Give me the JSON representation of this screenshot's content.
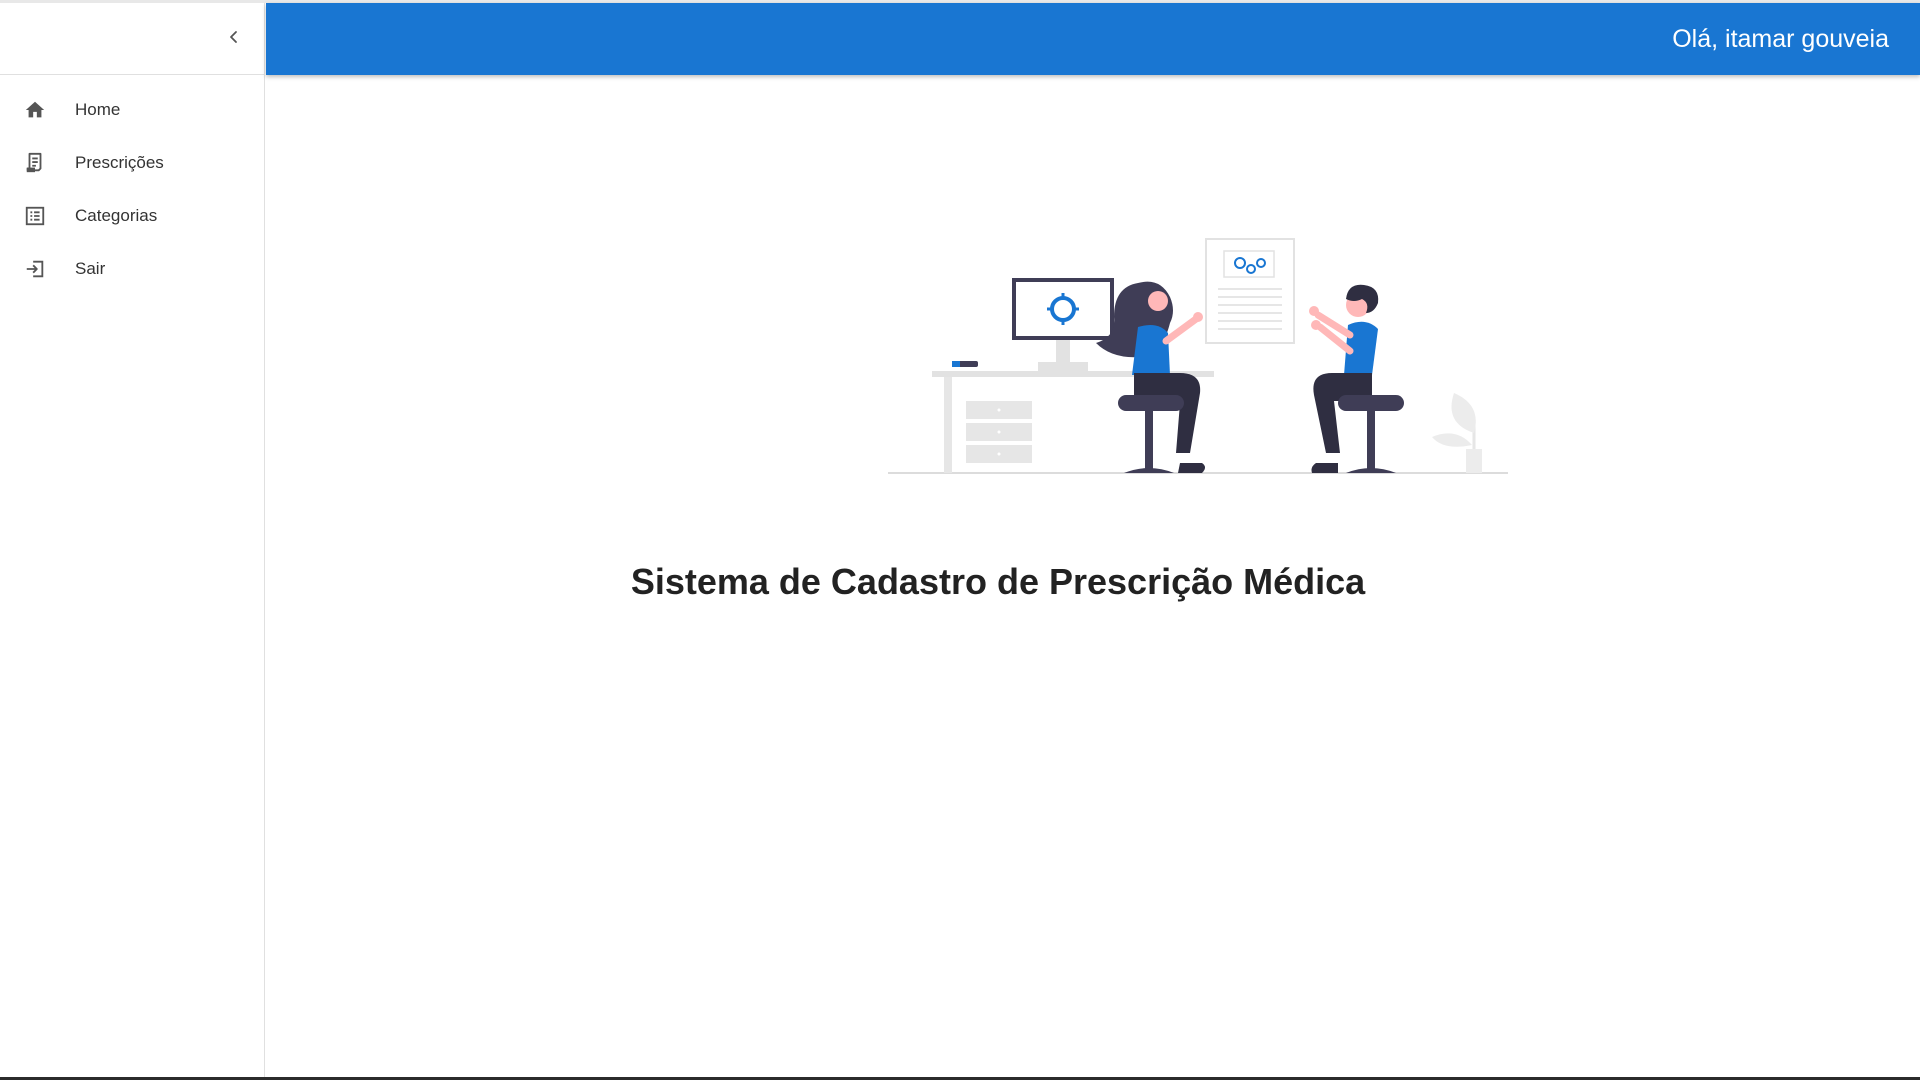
{
  "header": {
    "greeting": "Olá, itamar gouveia",
    "background_color": "#1976d2"
  },
  "sidebar": {
    "collapse_icon": "chevron-left-icon",
    "items": [
      {
        "label": "Home",
        "icon": "home-icon"
      },
      {
        "label": "Prescrições",
        "icon": "receipt-icon"
      },
      {
        "label": "Categorias",
        "icon": "list-icon"
      },
      {
        "label": "Sair",
        "icon": "logout-icon"
      }
    ]
  },
  "main": {
    "title": "Sistema de Cadastro de Prescrição Médica",
    "illustration": "two-people-working-illustration",
    "accent_color": "#1976d2"
  }
}
